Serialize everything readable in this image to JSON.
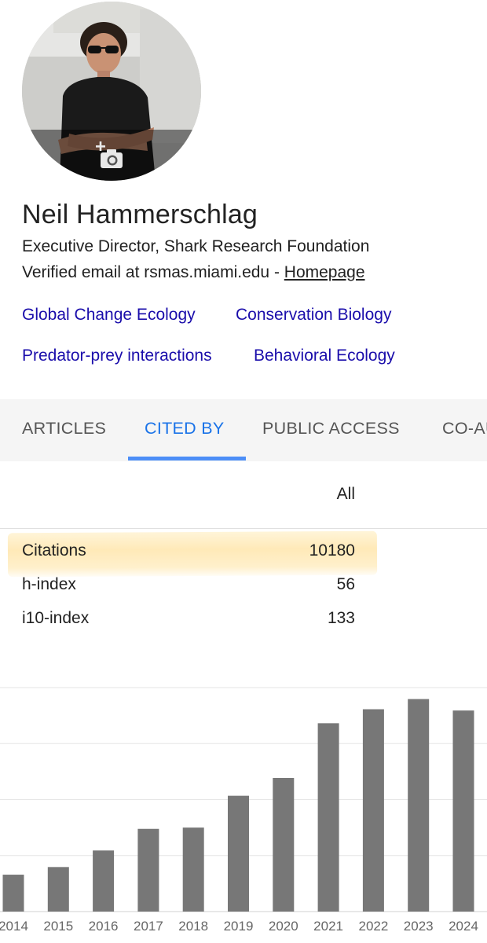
{
  "profile": {
    "name": "Neil Hammerschlag",
    "affiliation": "Executive Director, Shark Research Foundation",
    "verified_email": "Verified email at rsmas.miami.edu - ",
    "homepage_label": "Homepage",
    "photo_icon": "add-photo-camera-icon",
    "interests": [
      "Global Change Ecology",
      "Conservation Biology",
      "Predator-prey interactions",
      "Behavioral Ecology"
    ]
  },
  "tabs": [
    {
      "label": "ARTICLES",
      "active": false
    },
    {
      "label": "CITED BY",
      "active": true
    },
    {
      "label": "PUBLIC ACCESS",
      "active": false
    },
    {
      "label": "CO-AUTHORS",
      "active": false
    }
  ],
  "metrics": {
    "column_header": "All",
    "rows": [
      {
        "label": "Citations",
        "value": "10180",
        "highlighted": true
      },
      {
        "label": "h-index",
        "value": "56",
        "highlighted": false
      },
      {
        "label": "i10-index",
        "value": "133",
        "highlighted": false
      }
    ]
  },
  "colors": {
    "link": "#1a0dab",
    "active_tab": "#1a73e8",
    "tab_underline": "#4c8ef7",
    "bar": "#777777",
    "highlight": "#ffe4a8"
  },
  "chart_data": {
    "type": "bar",
    "categories": [
      "2014",
      "2015",
      "2016",
      "2017",
      "2018",
      "2019",
      "2020",
      "2021",
      "2022",
      "2023",
      "2024"
    ],
    "values": [
      290,
      350,
      480,
      650,
      660,
      910,
      1050,
      1480,
      1590,
      1670,
      1580
    ],
    "ylim": [
      0,
      1760
    ],
    "grid": true,
    "xlabel": "",
    "ylabel": ""
  }
}
